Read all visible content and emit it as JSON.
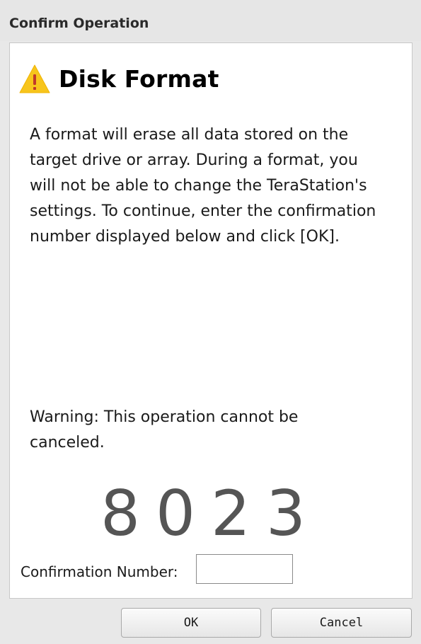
{
  "dialog": {
    "title": "Confirm Operation",
    "heading": "Disk Format",
    "icon": "warning-icon",
    "description_lines": [
      "A format will erase all data stored on the",
      "target drive or array. During a format, you",
      "will not be able to change the TeraStation's",
      "settings. To continue, enter the confirmation",
      "number displayed below and click [OK]."
    ],
    "warning_lines": [
      "Warning: This operation cannot be",
      "canceled."
    ],
    "confirmation_code": "8023",
    "confirmation_label": "Confirmation Number:",
    "confirmation_input_value": "",
    "ok_label": "OK",
    "cancel_label": "Cancel"
  },
  "colors": {
    "warning_icon_fill": "#f7c51c",
    "warning_icon_mark": "#c0392b",
    "title_bar_bg": "#e6e6e6",
    "code_color": "#555555"
  }
}
